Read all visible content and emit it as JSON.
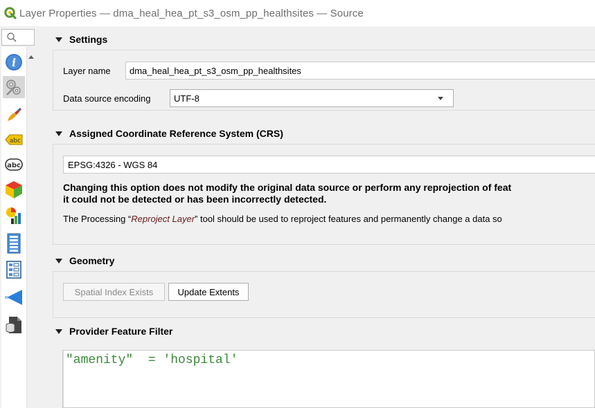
{
  "window": {
    "title": "Layer Properties — dma_heal_hea_pt_s3_osm_pp_healthsites — Source"
  },
  "sidebar": {
    "search_placeholder": "",
    "items": [
      {
        "name": "information",
        "icon": "info-icon",
        "selected": false
      },
      {
        "name": "source",
        "icon": "wrench-gear-icon",
        "selected": true
      },
      {
        "name": "symbology",
        "icon": "paintbrush-icon",
        "selected": false
      },
      {
        "name": "labels",
        "icon": "labels-abc-icon",
        "selected": false
      },
      {
        "name": "masks",
        "icon": "mask-abc-icon",
        "selected": false
      },
      {
        "name": "3d-view",
        "icon": "cube-icon",
        "selected": false
      },
      {
        "name": "diagrams",
        "icon": "diagram-icon",
        "selected": false
      },
      {
        "name": "fields",
        "icon": "fields-icon",
        "selected": false
      },
      {
        "name": "attributes-form",
        "icon": "form-icon",
        "selected": false
      },
      {
        "name": "joins",
        "icon": "join-icon",
        "selected": false
      },
      {
        "name": "auxiliary-storage",
        "icon": "storage-icon",
        "selected": false
      }
    ]
  },
  "settings": {
    "header": "Settings",
    "layer_name_label": "Layer name",
    "layer_name_value": "dma_heal_hea_pt_s3_osm_pp_healthsites",
    "encoding_label": "Data source encoding",
    "encoding_value": "UTF-8"
  },
  "crs": {
    "header": "Assigned Coordinate Reference System (CRS)",
    "value": "EPSG:4326 - WGS 84",
    "warning_line1": "Changing this option does not modify the original data source or perform any reprojection of feat",
    "warning_line2": "it could not be detected or has been incorrectly detected.",
    "note_prefix": "The Processing “",
    "note_tool": "Reproject Layer",
    "note_suffix": "” tool should be used to reproject features and permanently change a data so"
  },
  "geometry": {
    "header": "Geometry",
    "spatial_index_label": "Spatial Index Exists",
    "update_extents_label": "Update Extents"
  },
  "filter": {
    "header": "Provider Feature Filter",
    "expression": "\"amenity\"  = 'hospital'"
  },
  "colors": {
    "qgis_green": "#589632",
    "filter_text": "#3c8a3c"
  }
}
